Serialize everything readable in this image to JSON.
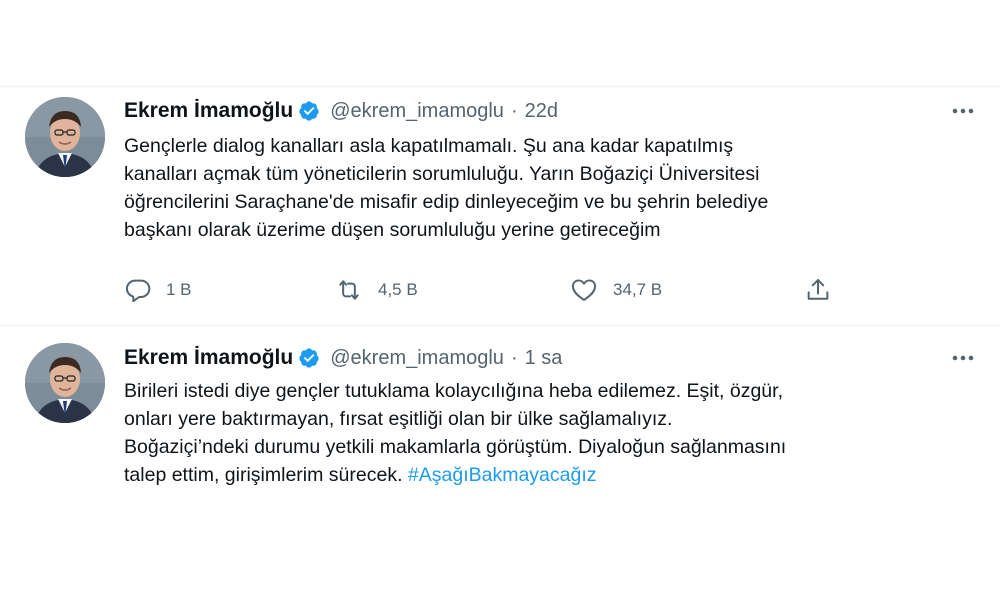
{
  "tweets": [
    {
      "author_name": "Ekrem İmamoğlu",
      "handle": "@ekrem_imamoglu",
      "separator": "·",
      "time": "22d",
      "text_lines": [
        "Gençlerle dialog kanalları asla kapatılmamalı. Şu ana kadar kapatılmış",
        "kanalları açmak tüm yöneticilerin sorumluluğu. Yarın Boğaziçi Üniversitesi",
        "öğrencilerini Saraçhane'de misafir edip dinleyeceğim ve bu şehrin belediye",
        "başkanı olarak üzerime düşen sorumluluğu yerine getireceğim"
      ],
      "reply_count": "1 B",
      "retweet_count": "4,5 B",
      "like_count": "34,7 B"
    },
    {
      "author_name": "Ekrem İmamoğlu",
      "handle": "@ekrem_imamoglu",
      "separator": "·",
      "time": "1 sa",
      "text_lines": [
        "Birileri istedi diye gençler tutuklama kolaycılığına heba edilemez. Eşit, özgür,",
        "onları yere baktırmayan, fırsat eşitliği olan bir ülke sağlamalıyız.",
        "Boğaziçi’ndeki durumu yetkili makamlarla görüştüm. Diyaloğun sağlanmasını"
      ],
      "last_line_text": "talep ettim, girişimlerim sürecek.",
      "hashtag": "#AşağıBakmayacağız"
    }
  ],
  "icons": {
    "verified": "verified-badge-icon",
    "more": "more-options-icon",
    "reply": "reply-icon",
    "retweet": "retweet-icon",
    "like": "heart-icon",
    "share": "share-icon"
  },
  "colors": {
    "text": "#0f1419",
    "secondary": "#536471",
    "accent": "#1d9bf0",
    "divider": "#eff3f4"
  }
}
